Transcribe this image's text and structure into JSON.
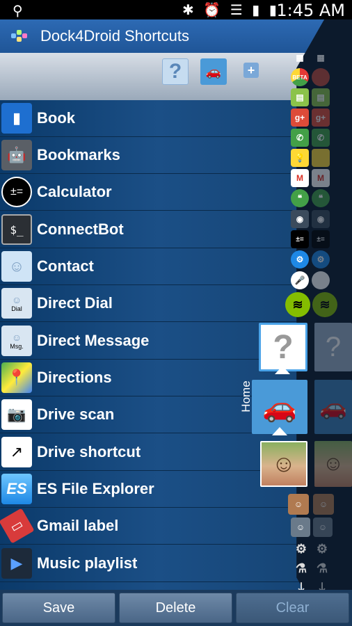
{
  "status_bar": {
    "time": "1:45 AM"
  },
  "action_bar": {
    "title": "Dock4Droid Shortcuts"
  },
  "toolbar": {
    "unknown_icon": "?",
    "car_icon": "car",
    "add_icon": "+"
  },
  "list": {
    "items": [
      {
        "label": "Book",
        "icon": "book-icon"
      },
      {
        "label": "Bookmarks",
        "icon": "android-icon"
      },
      {
        "label": "Calculator",
        "icon": "calculator-icon"
      },
      {
        "label": "ConnectBot",
        "icon": "terminal-icon"
      },
      {
        "label": "Contact",
        "icon": "contact-icon"
      },
      {
        "label": "Direct Dial",
        "icon": "direct-dial-icon",
        "badge": "Dial"
      },
      {
        "label": "Direct Message",
        "icon": "direct-message-icon",
        "badge": "Msg."
      },
      {
        "label": "Directions",
        "icon": "maps-icon"
      },
      {
        "label": "Drive scan",
        "icon": "drive-scan-icon"
      },
      {
        "label": "Drive shortcut",
        "icon": "drive-shortcut-icon"
      },
      {
        "label": "ES File Explorer",
        "icon": "es-file-explorer-icon"
      },
      {
        "label": "Gmail label",
        "icon": "gmail-label-icon"
      },
      {
        "label": "Music playlist",
        "icon": "play-icon"
      }
    ]
  },
  "dock": {
    "home_label": "Home",
    "beta_badge": "BETA"
  },
  "bottom_bar": {
    "save": "Save",
    "delete": "Delete",
    "clear": "Clear"
  },
  "colors": {
    "accent": "#2d6ab4",
    "list_bg": "#1b4f86",
    "dock_bg": "#0c1a2c"
  }
}
